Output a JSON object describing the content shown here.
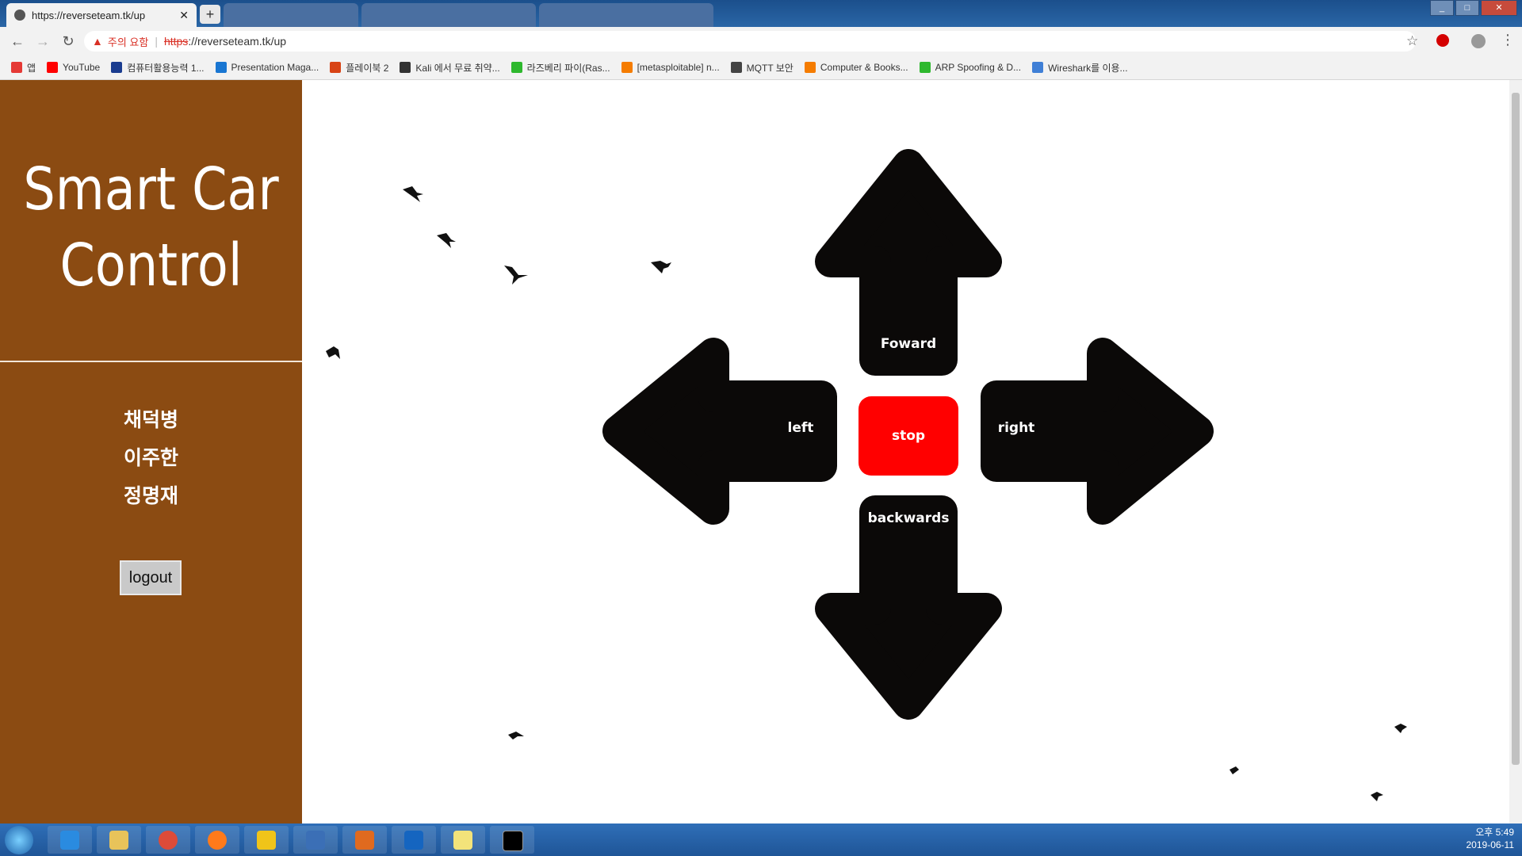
{
  "browser": {
    "active_tab_title": "https://reverseteam.tk/up",
    "address": {
      "warning": "주의 요함",
      "scheme": "https",
      "url_rest": "://reverseteam.tk/up"
    },
    "bookmarks": [
      {
        "label": "앱",
        "color": "#e53935"
      },
      {
        "label": "YouTube",
        "color": "#ff0000"
      },
      {
        "label": "컴퓨터활용능력 1...",
        "color": "#1a3c8f"
      },
      {
        "label": "Presentation Maga...",
        "color": "#1976d2"
      },
      {
        "label": "플레이북 2",
        "color": "#d84315"
      },
      {
        "label": "Kali 에서 무료 취약...",
        "color": "#333333"
      },
      {
        "label": "라즈베리 파이(Ras...",
        "color": "#2eb82e"
      },
      {
        "label": "[metasploitable] n...",
        "color": "#f57c00"
      },
      {
        "label": "MQTT 보안",
        "color": "#444444"
      },
      {
        "label": "Computer & Books...",
        "color": "#f57c00"
      },
      {
        "label": "ARP Spoofing & D...",
        "color": "#2eb82e"
      },
      {
        "label": "Wireshark를 이용...",
        "color": "#3f7fd6"
      }
    ]
  },
  "sidebar": {
    "title_line1": "Smart Car",
    "title_line2": "Control",
    "members": [
      "채덕병",
      "이주한",
      "정명재"
    ],
    "logout_label": "logout",
    "bg_color": "#8b4b12"
  },
  "controls": {
    "forward_label": "Foward",
    "left_label": "left",
    "right_label": "right",
    "backwards_label": "backwards",
    "stop_label": "stop",
    "stop_color": "#ff0000"
  },
  "taskbar": {
    "clock_time": "오후 5:49",
    "clock_date": "2019-06-11"
  }
}
